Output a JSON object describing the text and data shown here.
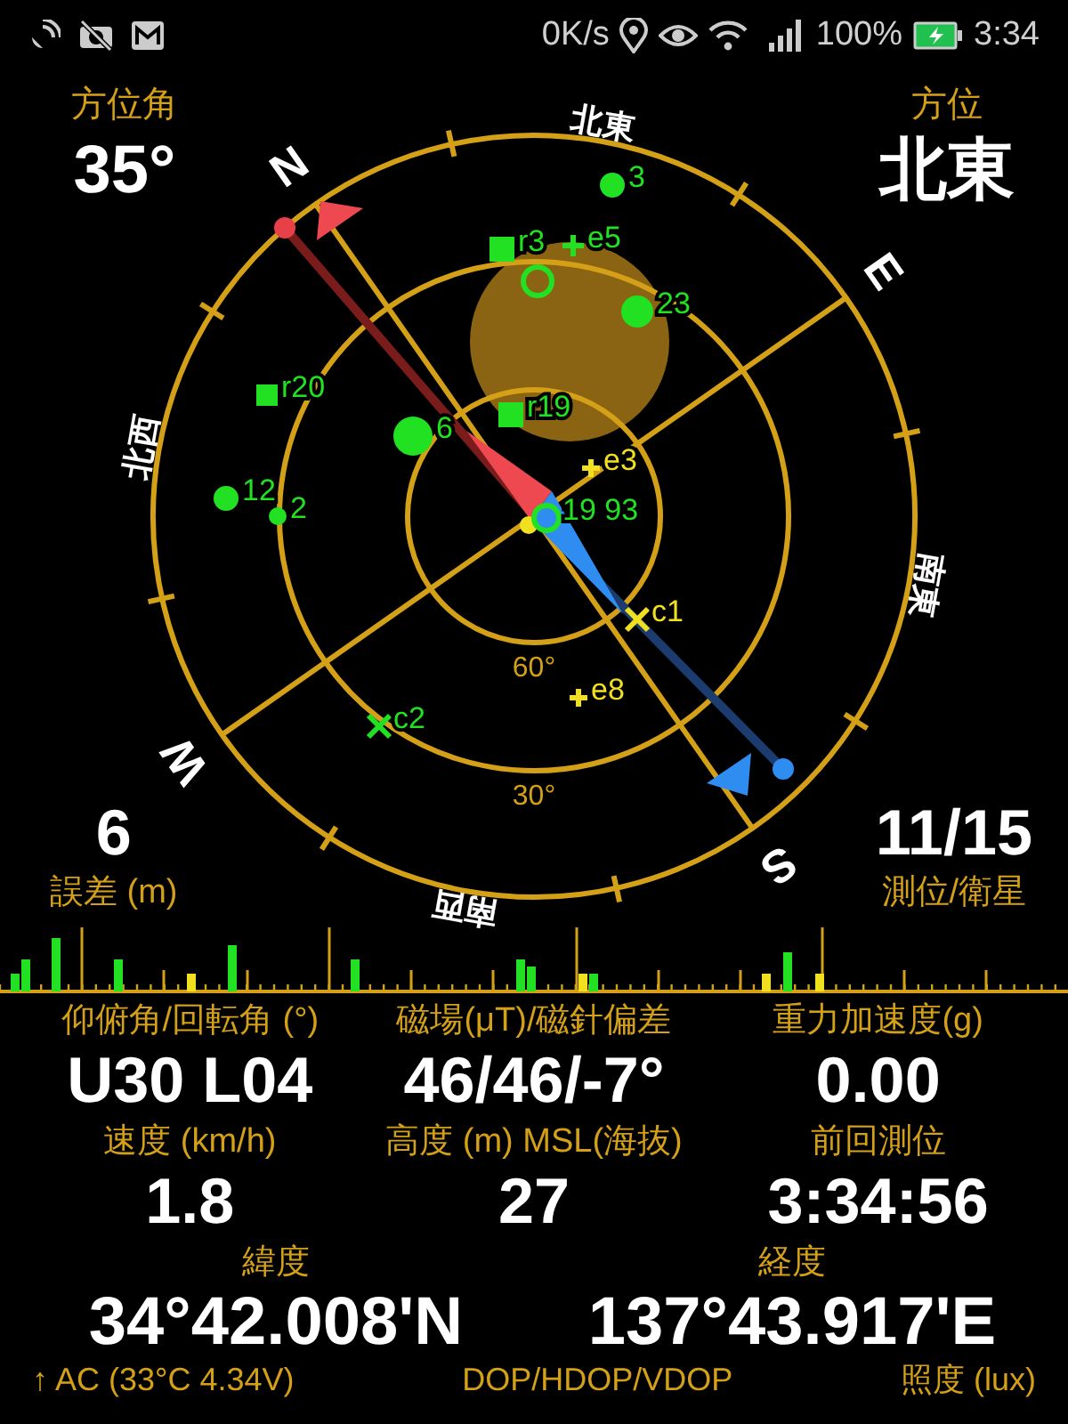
{
  "status_bar": {
    "speed": "0K/s",
    "battery": "100%",
    "time": "3:34"
  },
  "compass": {
    "azimuth_label": "方位角",
    "azimuth": "35°",
    "direction_label": "方位",
    "direction": "北東",
    "cardinals": [
      "N",
      "E",
      "S",
      "W"
    ],
    "intercardinals": [
      "北東",
      "南東",
      "南西",
      "北西"
    ],
    "elevation_labels": [
      "60°",
      "30°"
    ],
    "satellites": [
      {
        "kind": "circle",
        "label": "3",
        "color": "#22e022"
      },
      {
        "kind": "square",
        "label": "r3",
        "color": "#22e022"
      },
      {
        "kind": "ring",
        "color": "#22e022"
      },
      {
        "kind": "plus",
        "label": "e5",
        "color": "#22e022"
      },
      {
        "kind": "circle",
        "label": "23",
        "color": "#22e022"
      },
      {
        "kind": "square",
        "label": "r20",
        "color": "#22e022"
      },
      {
        "kind": "square",
        "label": "r19",
        "color": "#22e022"
      },
      {
        "kind": "circle",
        "label": "6",
        "color": "#22e022"
      },
      {
        "kind": "circle",
        "label": "12",
        "color": "#22e022"
      },
      {
        "kind": "circle",
        "label": "2",
        "color": "#22e022"
      },
      {
        "kind": "plus",
        "label": "e3",
        "color": "#f0e020"
      },
      {
        "kind": "circle",
        "color": "#f0e020"
      },
      {
        "kind": "ring",
        "label": "19 93",
        "color": "#22e022"
      },
      {
        "kind": "cross",
        "label": "c1",
        "color": "#f0e020"
      },
      {
        "kind": "plus",
        "label": "e8",
        "color": "#f0e020"
      },
      {
        "kind": "cross",
        "label": "c2",
        "color": "#22e022"
      }
    ],
    "error": "6",
    "error_label": "誤差 (m)",
    "fix": "11/15",
    "fix_label": "測位/衛星"
  },
  "readings": [
    {
      "label": "仰俯角/回転角 (°)",
      "value": "U30 L04"
    },
    {
      "label": "磁場(μT)/磁針偏差",
      "value": "46/46/-7°"
    },
    {
      "label": "重力加速度(g)",
      "value": "0.00"
    },
    {
      "label": "速度 (km/h)",
      "value": "1.8"
    },
    {
      "label": "高度 (m) MSL(海抜)",
      "value": "27"
    },
    {
      "label": "前回測位",
      "value": "3:34:56"
    }
  ],
  "coordinates": [
    {
      "label": "緯度",
      "value": "34°42.008'N"
    },
    {
      "label": "経度",
      "value": "137°43.917'E"
    }
  ],
  "footer": [
    "↑ AC (33°C 4.34V)",
    "DOP/HDOP/VDOP",
    "照度 (lux)"
  ]
}
